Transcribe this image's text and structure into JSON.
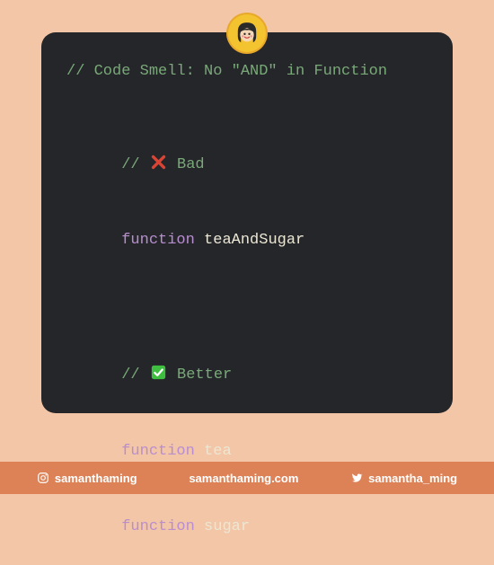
{
  "title_comment": "// Code Smell: No \"AND\" in Function",
  "bad": {
    "comment_prefix": "// ",
    "emoji": "cross-mark",
    "comment_suffix": " Bad",
    "code_keyword": "function",
    "code_ident": " teaAndSugar"
  },
  "better": {
    "comment_prefix": "// ",
    "emoji": "check-mark",
    "comment_suffix": " Better",
    "line1_keyword": "function",
    "line1_ident": " tea",
    "line2_keyword": "function",
    "line2_ident": " sugar"
  },
  "footer": {
    "instagram": "samanthaming",
    "website": "samanthaming.com",
    "twitter": "samantha_ming"
  },
  "avatar_name": "author-avatar"
}
